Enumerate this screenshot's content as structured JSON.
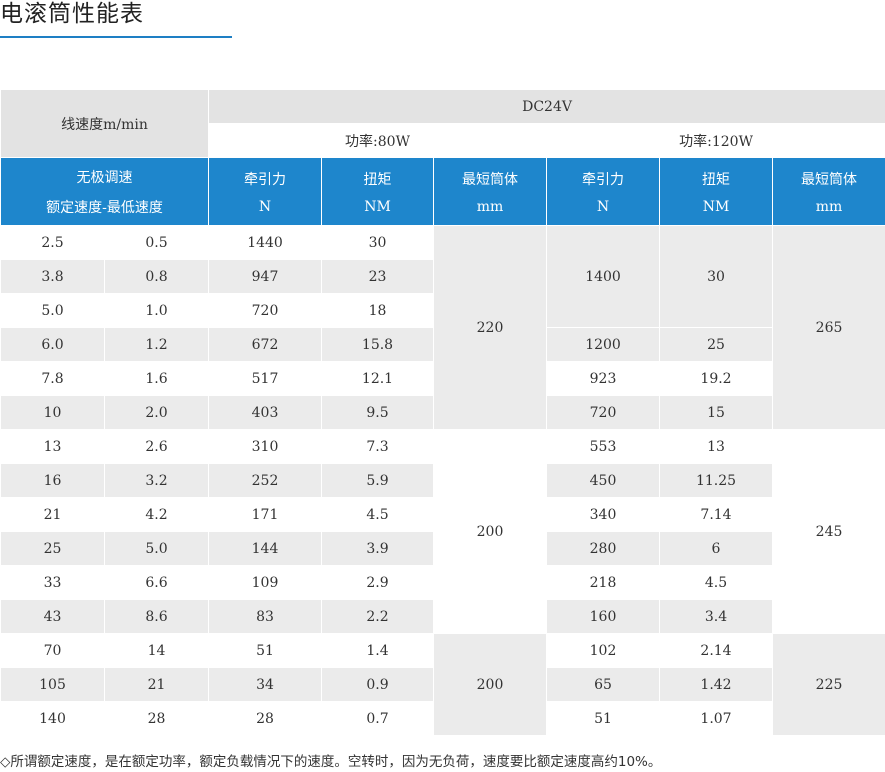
{
  "title": "电滚筒性能表",
  "table": {
    "speed_header": "线速度m/min",
    "voltage": "DC24V",
    "power_80": "功率:80W",
    "power_120": "功率:120W",
    "col_speed_line1": "无极调速",
    "col_speed_line2": "额定速度-最低速度",
    "col_force": "牵引力",
    "col_force_unit": "N",
    "col_torque": "扭矩",
    "col_torque_unit": "NM",
    "col_drum": "最短筒体",
    "col_drum_unit": "mm",
    "rows": [
      {
        "rated": "2.5",
        "min": "0.5",
        "f80": "1440",
        "t80": "30"
      },
      {
        "rated": "3.8",
        "min": "0.8",
        "f80": "947",
        "t80": "23"
      },
      {
        "rated": "5.0",
        "min": "1.0",
        "f80": "720",
        "t80": "18"
      },
      {
        "rated": "6.0",
        "min": "1.2",
        "f80": "672",
        "t80": "15.8"
      },
      {
        "rated": "7.8",
        "min": "1.6",
        "f80": "517",
        "t80": "12.1"
      },
      {
        "rated": "10",
        "min": "2.0",
        "f80": "403",
        "t80": "9.5"
      },
      {
        "rated": "13",
        "min": "2.6",
        "f80": "310",
        "t80": "7.3"
      },
      {
        "rated": "16",
        "min": "3.2",
        "f80": "252",
        "t80": "5.9"
      },
      {
        "rated": "21",
        "min": "4.2",
        "f80": "171",
        "t80": "4.5"
      },
      {
        "rated": "25",
        "min": "5.0",
        "f80": "144",
        "t80": "3.9"
      },
      {
        "rated": "33",
        "min": "6.6",
        "f80": "109",
        "t80": "2.9"
      },
      {
        "rated": "43",
        "min": "8.6",
        "f80": "83",
        "t80": "2.2"
      },
      {
        "rated": "70",
        "min": "14",
        "f80": "51",
        "t80": "1.4"
      },
      {
        "rated": "105",
        "min": "21",
        "f80": "34",
        "t80": "0.9"
      },
      {
        "rated": "140",
        "min": "28",
        "f80": "28",
        "t80": "0.7"
      }
    ],
    "w120": [
      {
        "force": "1400",
        "torque": "30"
      },
      {
        "force": "1200",
        "torque": "25"
      },
      {
        "force": "923",
        "torque": "19.2"
      },
      {
        "force": "720",
        "torque": "15"
      },
      {
        "force": "553",
        "torque": "13"
      },
      {
        "force": "450",
        "torque": "11.25"
      },
      {
        "force": "340",
        "torque": "7.14"
      },
      {
        "force": "280",
        "torque": "6"
      },
      {
        "force": "218",
        "torque": "4.5"
      },
      {
        "force": "160",
        "torque": "3.4"
      },
      {
        "force": "102",
        "torque": "2.14"
      },
      {
        "force": "65",
        "torque": "1.42"
      },
      {
        "force": "51",
        "torque": "1.07"
      }
    ],
    "drum80": [
      "220",
      "200",
      "200"
    ],
    "drum120": [
      "265",
      "245",
      "225"
    ]
  },
  "footnote": "◇所谓额定速度，是在额定功率，额定负载情况下的速度。空转时，因为无负荷，速度要比额定速度高约10%。"
}
